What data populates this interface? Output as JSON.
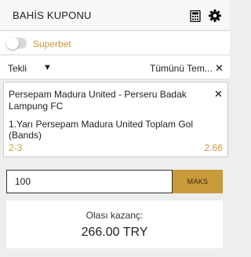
{
  "header": {
    "title": "BAHİS KUPONU",
    "icons": [
      "calculator-icon",
      "gear-icon"
    ]
  },
  "superbet": {
    "label": "Superbet",
    "enabled": false,
    "accent_color": "#c99a3a"
  },
  "bet_type": {
    "selected": "Tekli",
    "clear_all_label": "Tümünü Tem..."
  },
  "bet": {
    "match": "Persepam Madura United - Perseru Badak Lampung FC",
    "market": "1.Yarı Persepam Madura United Toplam Gol (Bands)",
    "selection": "2-3",
    "odds": "2.66"
  },
  "stake": {
    "value": "100",
    "max_label": "MAKS"
  },
  "winnings": {
    "label": "Olası kazanç:",
    "amount": "266.00 TRY"
  }
}
